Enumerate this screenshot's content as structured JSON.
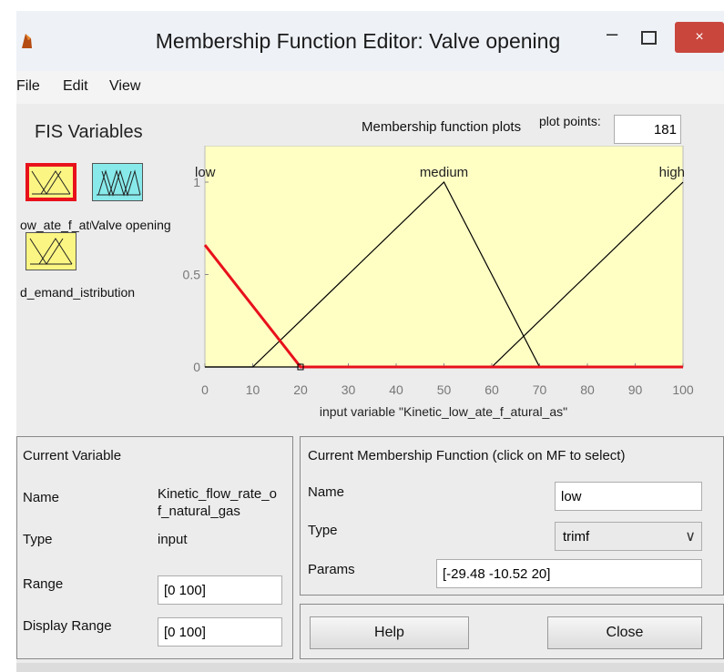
{
  "window": {
    "title": "Membership Function Editor: Valve opening",
    "close_glyph": "×"
  },
  "menu": [
    "File",
    "Edit",
    "View"
  ],
  "fis_variables": {
    "label": "FIS Variables",
    "items": [
      {
        "label": "ow_ate_f_atural_as",
        "kind": "input",
        "selected": true
      },
      {
        "label": "Valve opening",
        "kind": "output",
        "selected": false
      },
      {
        "label": "d_emand_istribution",
        "kind": "input",
        "selected": false
      }
    ]
  },
  "plot_header": {
    "label": "Membership function plots",
    "plot_points_label": "plot points:",
    "plot_points": "181"
  },
  "chart_data": {
    "type": "line",
    "xlabel": "input variable \"Kinetic_low_ate_f_atural_as\"",
    "xlim": [
      0,
      100
    ],
    "ylim": [
      0,
      1
    ],
    "xticks": [
      0,
      10,
      20,
      30,
      40,
      50,
      60,
      70,
      80,
      90,
      100
    ],
    "yticks": [
      0,
      0.5,
      1
    ],
    "ytick_labels": [
      "0",
      "0.5",
      "1"
    ],
    "series": [
      {
        "name": "low",
        "color": "#e8111b",
        "selected": true,
        "points": [
          [
            0,
            0.66
          ],
          [
            20,
            0
          ],
          [
            100,
            0
          ]
        ]
      },
      {
        "name": "medium",
        "color": "#000000",
        "selected": false,
        "points": [
          [
            0,
            0
          ],
          [
            10,
            0
          ],
          [
            50,
            1
          ],
          [
            70,
            0
          ],
          [
            100,
            0
          ]
        ]
      },
      {
        "name": "high",
        "color": "#000000",
        "selected": false,
        "points": [
          [
            0,
            0
          ],
          [
            60,
            0
          ],
          [
            100,
            1
          ]
        ]
      }
    ],
    "background": "#ffffc4"
  },
  "current_variable": {
    "title": "Current Variable",
    "name_label": "Name",
    "name_value_line1": "Kinetic_flow_rate_o",
    "name_value_line2": "f_natural_gas",
    "type_label": "Type",
    "type_value": "input",
    "range_label": "Range",
    "range_value": "[0 100]",
    "display_range_label": "Display Range",
    "display_range_value": "[0 100]"
  },
  "current_mf": {
    "title": "Current Membership Function (click on MF to select)",
    "name_label": "Name",
    "name_value": "low",
    "type_label": "Type",
    "type_value": "trimf",
    "params_label": "Params",
    "params_value": "[-29.48 -10.52 20]"
  },
  "buttons": {
    "help": "Help",
    "close": "Close"
  },
  "colors": {
    "selected_border": "#e8111b",
    "input_var_fill": "#fbf583",
    "output_var_fill": "#88e9ea",
    "close_button": "#c9463d"
  }
}
